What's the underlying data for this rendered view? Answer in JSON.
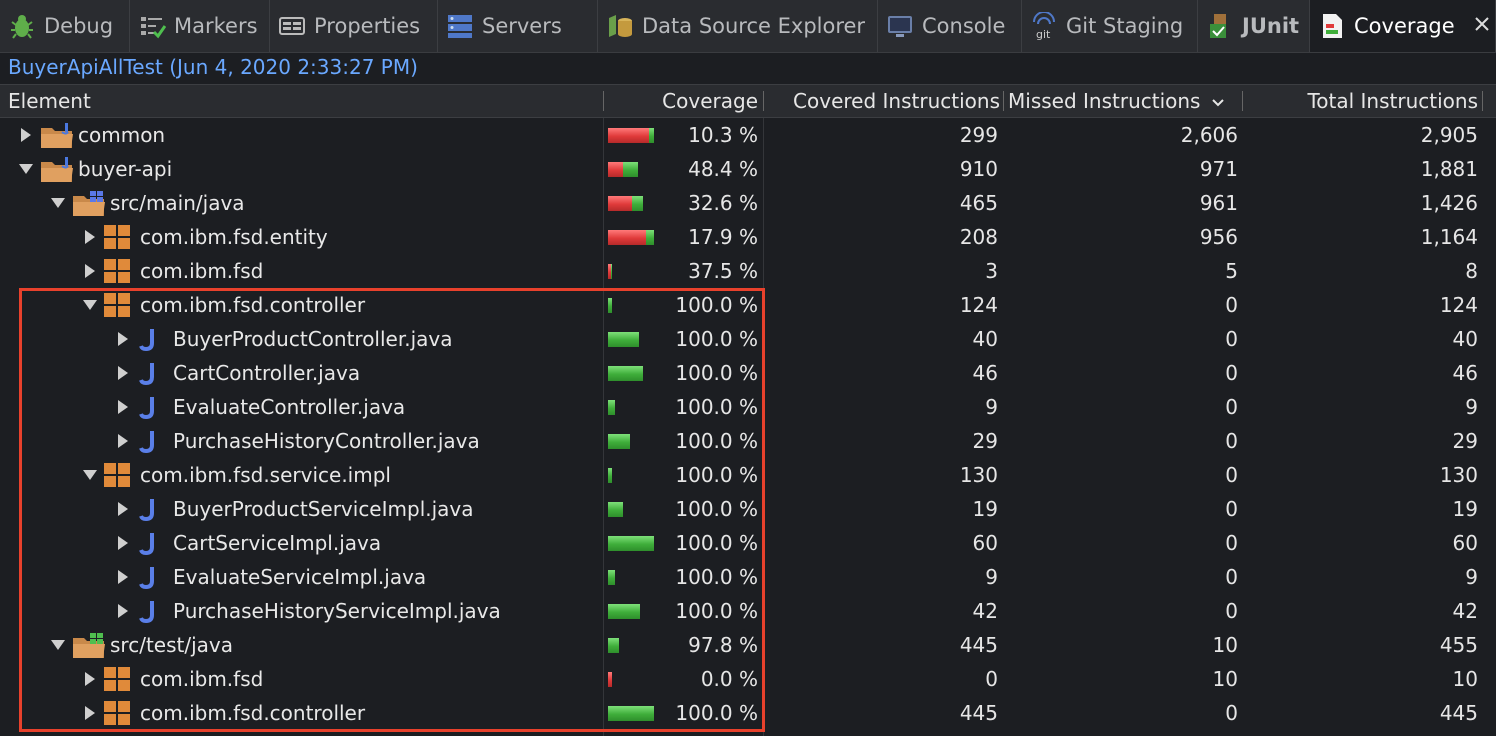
{
  "tabs": [
    {
      "label": "Debug",
      "icon": "bug-icon",
      "active": false
    },
    {
      "label": "Markers",
      "icon": "markers-icon",
      "active": false
    },
    {
      "label": "Properties",
      "icon": "properties-icon",
      "active": false
    },
    {
      "label": "Servers",
      "icon": "servers-icon",
      "active": false
    },
    {
      "label": "Data Source Explorer",
      "icon": "database-icon",
      "active": false
    },
    {
      "label": "Console",
      "icon": "console-icon",
      "active": false
    },
    {
      "label": "Git Staging",
      "icon": "git-icon",
      "active": false
    },
    {
      "label": "JUnit",
      "icon": "junit-icon",
      "active": false
    },
    {
      "label": "Coverage",
      "icon": "coverage-icon",
      "active": true
    }
  ],
  "session_title": "BuyerApiAllTest (Jun 4, 2020 2:33:27 PM)",
  "columns": {
    "element": "Element",
    "coverage": "Coverage",
    "covered": "Covered Instructions",
    "missed": "Missed Instructions",
    "total": "Total Instructions"
  },
  "sort_icon": "chevron-down-icon",
  "colors": {
    "highlight": "#e8412c",
    "accent": "#6aa8ff",
    "covered": "#3fae3a",
    "missed": "#e03a3a"
  },
  "rows": [
    {
      "name": "common",
      "type": "project",
      "expanded": false,
      "level": 0,
      "coverage": "10.3 %",
      "covered": "299",
      "missed": "2,606",
      "total": "2,905",
      "ratio": 0.103
    },
    {
      "name": "buyer-api",
      "type": "project",
      "expanded": true,
      "level": 0,
      "coverage": "48.4 %",
      "covered": "910",
      "missed": "971",
      "total": "1,881",
      "ratio": 0.484
    },
    {
      "name": "src/main/java",
      "type": "srcfolder",
      "expanded": true,
      "level": 1,
      "coverage": "32.6 %",
      "covered": "465",
      "missed": "961",
      "total": "1,426",
      "ratio": 0.326
    },
    {
      "name": "com.ibm.fsd.entity",
      "type": "package",
      "expanded": false,
      "level": 2,
      "coverage": "17.9 %",
      "covered": "208",
      "missed": "956",
      "total": "1,164",
      "ratio": 0.179
    },
    {
      "name": "com.ibm.fsd",
      "type": "package",
      "expanded": false,
      "level": 2,
      "coverage": "37.5 %",
      "covered": "3",
      "missed": "5",
      "total": "8",
      "ratio": 0.375
    },
    {
      "name": "com.ibm.fsd.controller",
      "type": "package",
      "expanded": true,
      "level": 2,
      "coverage": "100.0 %",
      "covered": "124",
      "missed": "0",
      "total": "124",
      "ratio": 1.0
    },
    {
      "name": "BuyerProductController.java",
      "type": "java",
      "expanded": false,
      "level": 3,
      "coverage": "100.0 %",
      "covered": "40",
      "missed": "0",
      "total": "40",
      "ratio": 1.0
    },
    {
      "name": "CartController.java",
      "type": "java",
      "expanded": false,
      "level": 3,
      "coverage": "100.0 %",
      "covered": "46",
      "missed": "0",
      "total": "46",
      "ratio": 1.0
    },
    {
      "name": "EvaluateController.java",
      "type": "java",
      "expanded": false,
      "level": 3,
      "coverage": "100.0 %",
      "covered": "9",
      "missed": "0",
      "total": "9",
      "ratio": 1.0
    },
    {
      "name": "PurchaseHistoryController.java",
      "type": "java",
      "expanded": false,
      "level": 3,
      "coverage": "100.0 %",
      "covered": "29",
      "missed": "0",
      "total": "29",
      "ratio": 1.0
    },
    {
      "name": "com.ibm.fsd.service.impl",
      "type": "package",
      "expanded": true,
      "level": 2,
      "coverage": "100.0 %",
      "covered": "130",
      "missed": "0",
      "total": "130",
      "ratio": 1.0
    },
    {
      "name": "BuyerProductServiceImpl.java",
      "type": "java",
      "expanded": false,
      "level": 3,
      "coverage": "100.0 %",
      "covered": "19",
      "missed": "0",
      "total": "19",
      "ratio": 1.0
    },
    {
      "name": "CartServiceImpl.java",
      "type": "java",
      "expanded": false,
      "level": 3,
      "coverage": "100.0 %",
      "covered": "60",
      "missed": "0",
      "total": "60",
      "ratio": 1.0
    },
    {
      "name": "EvaluateServiceImpl.java",
      "type": "java",
      "expanded": false,
      "level": 3,
      "coverage": "100.0 %",
      "covered": "9",
      "missed": "0",
      "total": "9",
      "ratio": 1.0
    },
    {
      "name": "PurchaseHistoryServiceImpl.java",
      "type": "java",
      "expanded": false,
      "level": 3,
      "coverage": "100.0 %",
      "covered": "42",
      "missed": "0",
      "total": "42",
      "ratio": 1.0
    },
    {
      "name": "src/test/java",
      "type": "testfolder",
      "expanded": true,
      "level": 1,
      "coverage": "97.8 %",
      "covered": "445",
      "missed": "10",
      "total": "455",
      "ratio": 0.978
    },
    {
      "name": "com.ibm.fsd",
      "type": "package",
      "expanded": false,
      "level": 2,
      "coverage": "0.0 %",
      "covered": "0",
      "missed": "10",
      "total": "10",
      "ratio": 0.0
    },
    {
      "name": "com.ibm.fsd.controller",
      "type": "package",
      "expanded": false,
      "level": 2,
      "coverage": "100.0 %",
      "covered": "445",
      "missed": "0",
      "total": "445",
      "ratio": 1.0
    }
  ]
}
